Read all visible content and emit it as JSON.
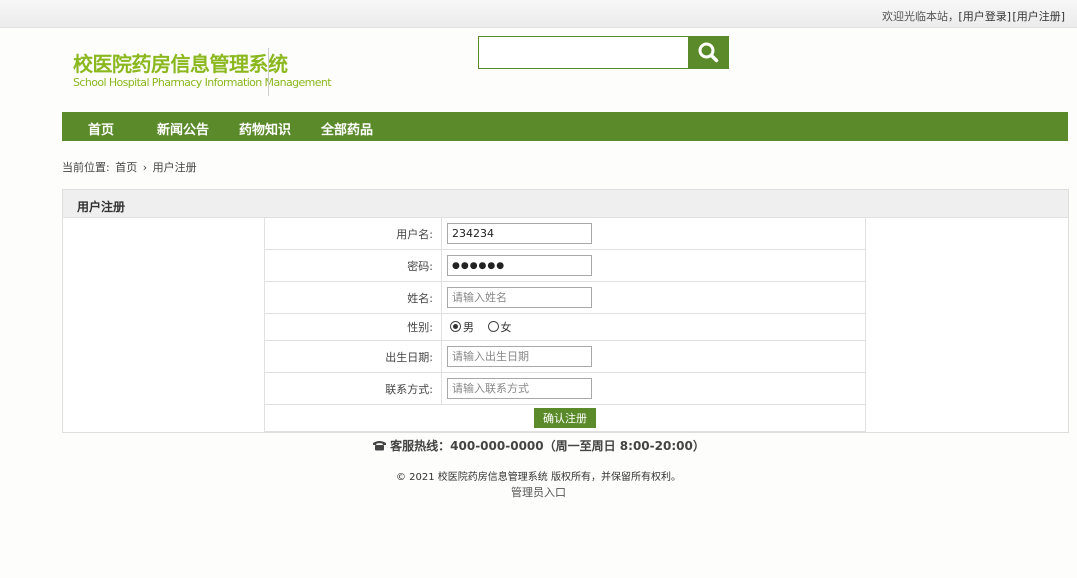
{
  "topbar": {
    "welcome": "欢迎光临本站，",
    "login_link": "[用户登录]",
    "register_link": "[用户注册]"
  },
  "logo": {
    "title": "校医院药房信息管理系统",
    "subtitle": "School Hospital Pharmacy Information Management"
  },
  "search": {
    "placeholder": "",
    "icon": "search-icon"
  },
  "nav": {
    "items": [
      {
        "label": "首页"
      },
      {
        "label": "新闻公告"
      },
      {
        "label": "药物知识"
      },
      {
        "label": "全部药品"
      }
    ]
  },
  "breadcrumb": {
    "prefix": "当前位置:",
    "home": "首页",
    "separator": "›",
    "current": "用户注册"
  },
  "panel": {
    "title": "用户注册"
  },
  "form": {
    "username_label": "用户名:",
    "username_value": "234234",
    "password_label": "密码:",
    "password_value": "●●●●●●",
    "name_label": "姓名:",
    "name_placeholder": "请输入姓名",
    "gender_label": "性别:",
    "gender_male": "男",
    "gender_female": "女",
    "gender_selected": "男",
    "birth_label": "出生日期:",
    "birth_placeholder": "请输入出生日期",
    "contact_label": "联系方式:",
    "contact_placeholder": "请输入联系方式",
    "submit_label": "确认注册"
  },
  "footer": {
    "hotline": "客服热线：400-000-0000（周一至周日 8:00-20:00）",
    "copyright": "© 2021 校医院药房信息管理系统 版权所有，并保留所有权利。",
    "admin_link": "管理员入口"
  },
  "colors": {
    "brand_green": "#5a8a2a",
    "logo_green": "#8bb81f"
  }
}
